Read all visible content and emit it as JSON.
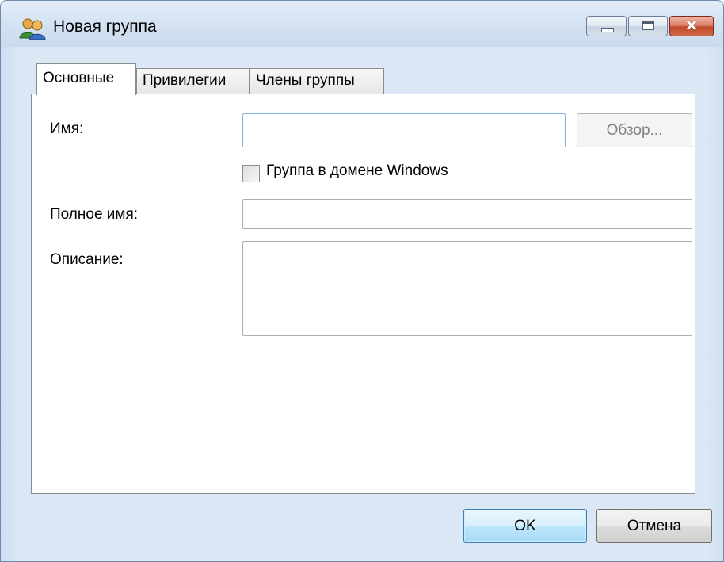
{
  "window": {
    "title": "Новая группа",
    "icon": "users-group-icon",
    "controls": {
      "minimize": "minimize-icon",
      "maximize": "maximize-icon",
      "close": "✕"
    }
  },
  "tabs": [
    {
      "label": "Основные",
      "active": true
    },
    {
      "label": "Привилегии",
      "active": false
    },
    {
      "label": "Члены группы",
      "active": false
    }
  ],
  "form": {
    "name_label": "Имя:",
    "name_value": "",
    "browse_button": "Обзор...",
    "domain_checkbox_label": "Группа в домене Windows",
    "domain_checkbox_checked": false,
    "fullname_label": "Полное имя:",
    "fullname_value": "",
    "description_label": "Описание:",
    "description_value": ""
  },
  "buttons": {
    "ok": "OK",
    "cancel": "Отмена"
  },
  "colors": {
    "title_bar": "#d3e1f1",
    "close_button": "#c14a2b",
    "focus_border": "#7eb4ea"
  }
}
